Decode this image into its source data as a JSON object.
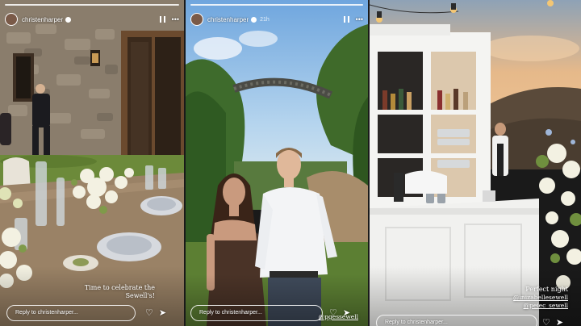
{
  "stories": [
    {
      "username": "christenharper",
      "reply_placeholder": "Reply to christenharper...",
      "caption_line1": "Time to celebrate the",
      "caption_line2": "Sewell's!",
      "reply_icon": "heart-icon",
      "share_icon": "send-icon"
    },
    {
      "username": "christenharper",
      "time_ago": "21h",
      "reply_placeholder": "Reply to christenharper...",
      "caption_mention": "@pgessewell"
    },
    {
      "reply_placeholder": "Reply to christenharper...",
      "caption_line1": "Perfect night",
      "mention1": "@inizabellesewell",
      "mention2": "@peiec_sewell"
    }
  ],
  "colors": {
    "stone": "#8c8070",
    "lawn": "#6c8a3a",
    "sky": "#9cc3e6",
    "sunset": "#e8b57a",
    "bar_white": "#f4f4f2"
  }
}
